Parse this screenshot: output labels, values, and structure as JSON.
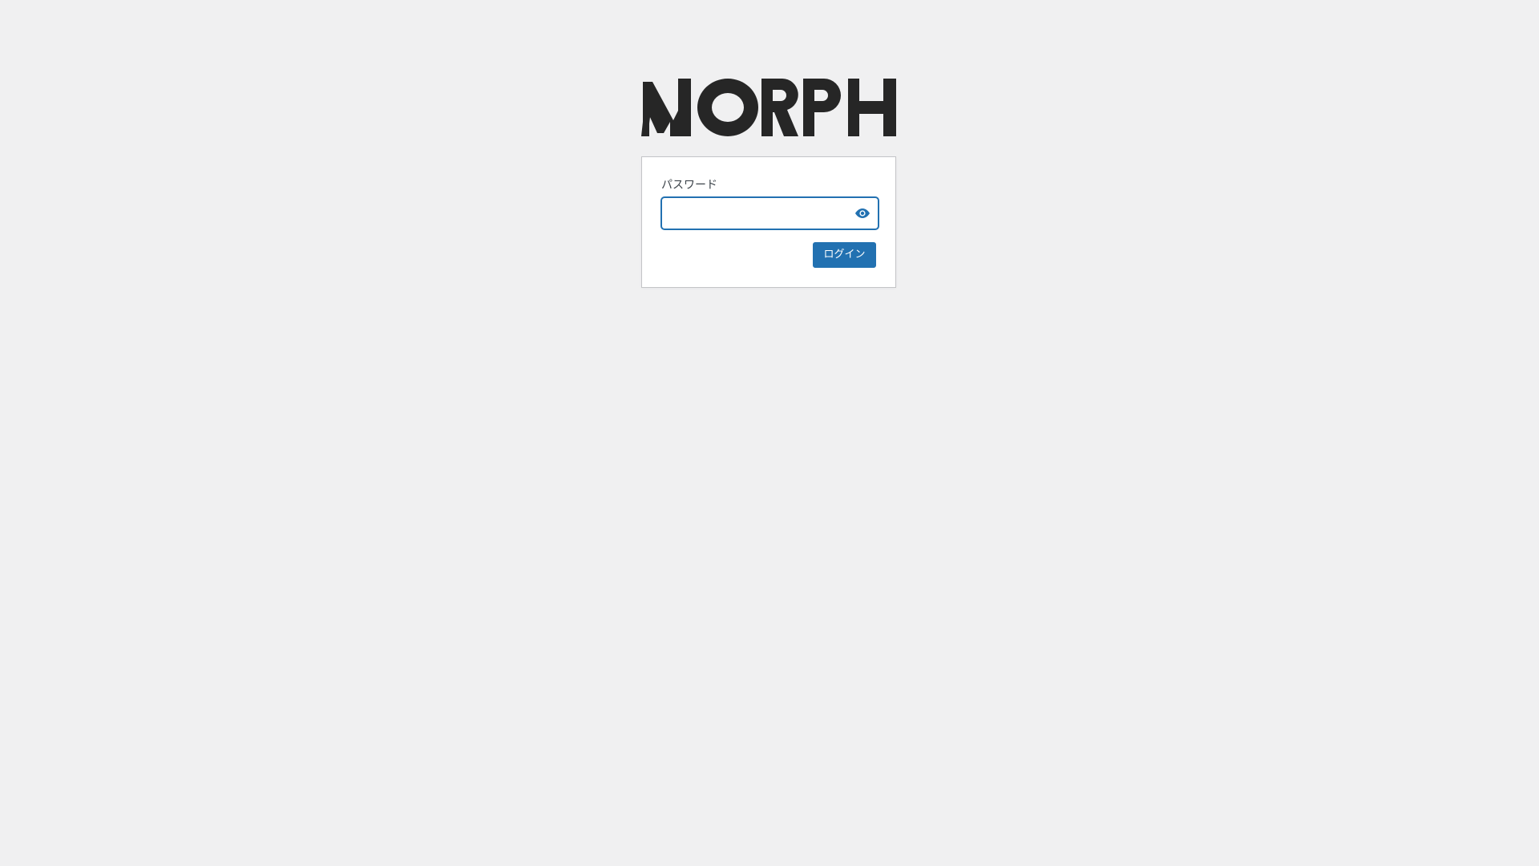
{
  "brand": {
    "logo_text": "MORPH",
    "logo_icon": "morph-wordmark-logo",
    "logo_color": "#262626"
  },
  "login_form": {
    "password_label": "パスワード",
    "password_value": "",
    "toggle_icon": "eye-icon",
    "submit_label": "ログイン"
  },
  "colors": {
    "background": "#f0f0f1",
    "accent": "#2271b1",
    "card": "#ffffff"
  }
}
